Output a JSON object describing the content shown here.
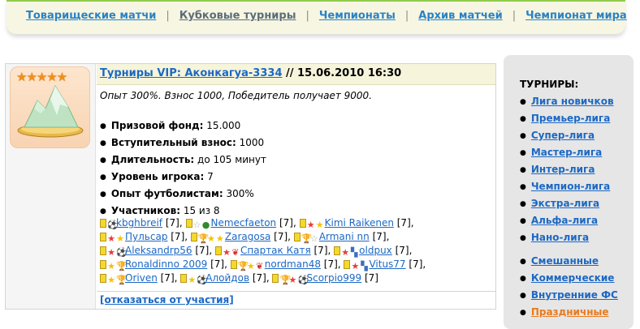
{
  "nav": {
    "items": [
      {
        "label": "Товарищеские матчи"
      },
      {
        "label": "Кубковые турниры"
      },
      {
        "label": "Чемпионаты"
      },
      {
        "label": "Архив матчей"
      },
      {
        "label": "Чемпионат мира"
      }
    ],
    "separator": "|"
  },
  "tournament": {
    "rating_stars": "★★★★★",
    "title_link": "Турниры VIP: Аконкагуа-3334",
    "title_date": " // 15.06.2010 16:30",
    "description": "Опыт 300%. Взнос 1000, Победитель получает 9000.",
    "info": [
      {
        "label": "Призовой фонд:",
        "value": " 15.000"
      },
      {
        "label": "Вступительный взнос:",
        "value": " 1000"
      },
      {
        "label": "Длительность:",
        "value": " до 105 минут"
      },
      {
        "label": "Уровень игрока:",
        "value": " 7"
      },
      {
        "label": "Опыт футболистам:",
        "value": " 300%"
      },
      {
        "label": "Участников:",
        "value": " 15 из 8"
      }
    ],
    "players": [
      {
        "name": "kbghbreif",
        "level": " [7],",
        "icons": [
          "card",
          "ball"
        ]
      },
      {
        "name": "Nemecfaeton",
        "level": " [7],",
        "icons": [
          "card",
          "gstar",
          "globe"
        ]
      },
      {
        "name": "Kimi Raikenen",
        "level": " [7],",
        "icons": [
          "card",
          "rstar",
          "star"
        ]
      },
      {
        "name": "Пульсар",
        "level": " [7],",
        "icons": [
          "card",
          "rstar",
          "star"
        ]
      },
      {
        "name": "Zaragosa",
        "level": " [7],",
        "icons": [
          "card",
          "cup",
          "star",
          "star"
        ]
      },
      {
        "name": "Armani nn",
        "level": " [7],",
        "icons": [
          "card",
          "cup",
          "gstar"
        ]
      },
      {
        "name": "Aleksandrp56",
        "level": " [7],",
        "icons": [
          "card",
          "rstar",
          "ball"
        ]
      },
      {
        "name": "Спартак Катя",
        "level": " [7],",
        "icons": [
          "card",
          "rstar",
          "wing"
        ]
      },
      {
        "name": "oldpux",
        "level": " [7],",
        "icons": [
          "card",
          "rstar",
          "flag"
        ]
      },
      {
        "name": "Ronaldinno 2009",
        "level": " [7],",
        "icons": [
          "card",
          "star",
          "cup"
        ]
      },
      {
        "name": "nordman48",
        "level": " [7],",
        "icons": [
          "card",
          "cup",
          "star",
          "wing"
        ]
      },
      {
        "name": "Vitus77",
        "level": " [7],",
        "icons": [
          "card",
          "rstar",
          "flag"
        ]
      },
      {
        "name": "Oriven",
        "level": " [7],",
        "icons": [
          "card",
          "star",
          "cup"
        ]
      },
      {
        "name": "Алойдов",
        "level": " [7],",
        "icons": [
          "card",
          "star",
          "ball"
        ]
      },
      {
        "name": "Scorpio999",
        "level": " [7]",
        "icons": [
          "card",
          "cup",
          "rstar",
          "ball"
        ]
      }
    ],
    "withdraw_link": "[отказаться от участия]"
  },
  "sidebar": {
    "heading": "ТУРНИРЫ:",
    "group1": [
      "Лига новичков",
      "Премьер-лига",
      "Супер-лига",
      "Мастер-лига",
      "Интер-лига",
      "Чемпион-лига",
      "Экстра-лига",
      "Альфа-лига",
      "Нано-лига"
    ],
    "group2": [
      {
        "label": "Смешанные",
        "hot": false
      },
      {
        "label": "Коммерческие",
        "hot": false
      },
      {
        "label": "Внутренние ФС",
        "hot": false
      },
      {
        "label": "Праздничные",
        "hot": true
      }
    ]
  },
  "colors": {
    "link": "#1c68c4",
    "nav_bg": "#f7f6e2",
    "sidebar_bg": "#e6e6e6",
    "hot": "#e87a1e"
  },
  "icon_glyphs": {
    "card": "",
    "star": "★",
    "gstar": "☆",
    "rstar": "★",
    "cup": "🏆",
    "ball": "⚽",
    "globe": "●",
    "wing": "❦",
    "flag": "▚"
  }
}
